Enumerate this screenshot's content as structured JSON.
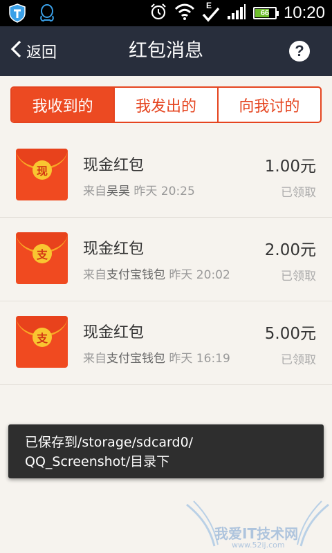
{
  "statusbar": {
    "time": "10:20",
    "battery": "66",
    "battery_level": 0.66,
    "network": "E"
  },
  "header": {
    "back_label": "返回",
    "title": "红包消息",
    "help_label": "?"
  },
  "tabs": [
    {
      "label": "我收到的",
      "active": true
    },
    {
      "label": "我发出的",
      "active": false
    },
    {
      "label": "向我讨的",
      "active": false
    }
  ],
  "items": [
    {
      "title": "现金红包",
      "from_prefix": "来自",
      "from": "吴昊",
      "time": "昨天 20:25",
      "amount": "1.00元",
      "status": "已领取",
      "seal": "现"
    },
    {
      "title": "现金红包",
      "from_prefix": "来自",
      "from": "支付宝钱包",
      "time": "昨天 20:02",
      "amount": "2.00元",
      "status": "已领取",
      "seal": "支"
    },
    {
      "title": "现金红包",
      "from_prefix": "来自",
      "from": "支付宝钱包",
      "time": "昨天 16:19",
      "amount": "5.00元",
      "status": "已领取",
      "seal": "支"
    }
  ],
  "toast": {
    "line1": "已保存到/storage/sdcard0/",
    "line2": "QQ_Screenshot/目录下"
  },
  "watermark": {
    "text": "我爱IT技术网",
    "url": "www.52ij.com"
  },
  "colors": {
    "accent": "#ec4a22",
    "header_bg": "#282e3c",
    "page_bg": "#f6f3ee"
  }
}
